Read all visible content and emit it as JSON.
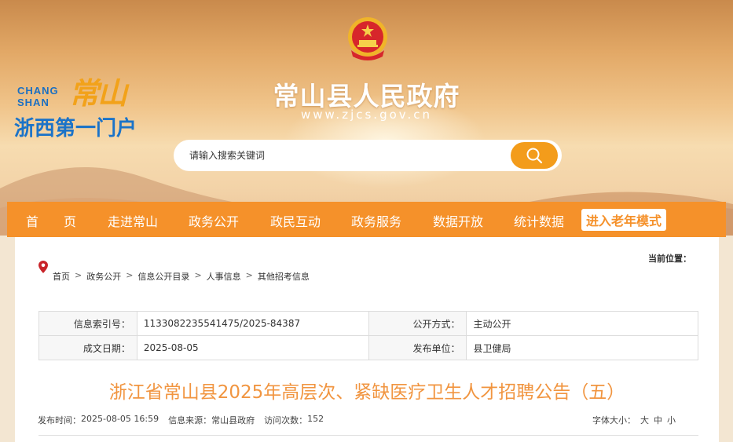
{
  "header": {
    "site_title": "常山县人民政府",
    "site_url": "www.zjcs.gov.cn",
    "logo_en_line1": "CHANG",
    "logo_en_line2": "SHAN",
    "logo_cn": "常山",
    "logo_slogan": "浙西第一门户",
    "emblem_icon": "national-emblem-icon"
  },
  "search": {
    "placeholder": "请输入搜索关键词",
    "icon": "search-icon"
  },
  "nav": {
    "items": [
      "首　　页",
      "走进常山",
      "政务公开",
      "政民互动",
      "政务服务",
      "数据开放",
      "统计数据"
    ],
    "elder_mode": "进入老年模式",
    "color": "#f5912a"
  },
  "breadcrumb": {
    "current_label": "当前位置：",
    "items": [
      "首页",
      "政务公开",
      "信息公开目录",
      "人事信息",
      "其他招考信息"
    ],
    "separator": ">"
  },
  "info": {
    "index_label": "信息索引号：",
    "index_value": "1133082235541475/2025-84387",
    "method_label": "公开方式：",
    "method_value": "主动公开",
    "date_label": "成文日期：",
    "date_value": "2025-08-05",
    "unit_label": "发布单位：",
    "unit_value": "县卫健局"
  },
  "article": {
    "title": "浙江省常山县2025年高层次、紧缺医疗卫生人才招聘公告（五）",
    "publish_label": "发布时间：",
    "publish_value": "2025-08-05 16:59",
    "source_label": "信息来源：",
    "source_value": "常山县政府",
    "visits_label": "访问次数：",
    "visits_value": "152",
    "fontsize_label": "字体大小：",
    "fontsize_large": "大",
    "fontsize_medium": "中",
    "fontsize_small": "小",
    "title_color": "#f19540"
  }
}
